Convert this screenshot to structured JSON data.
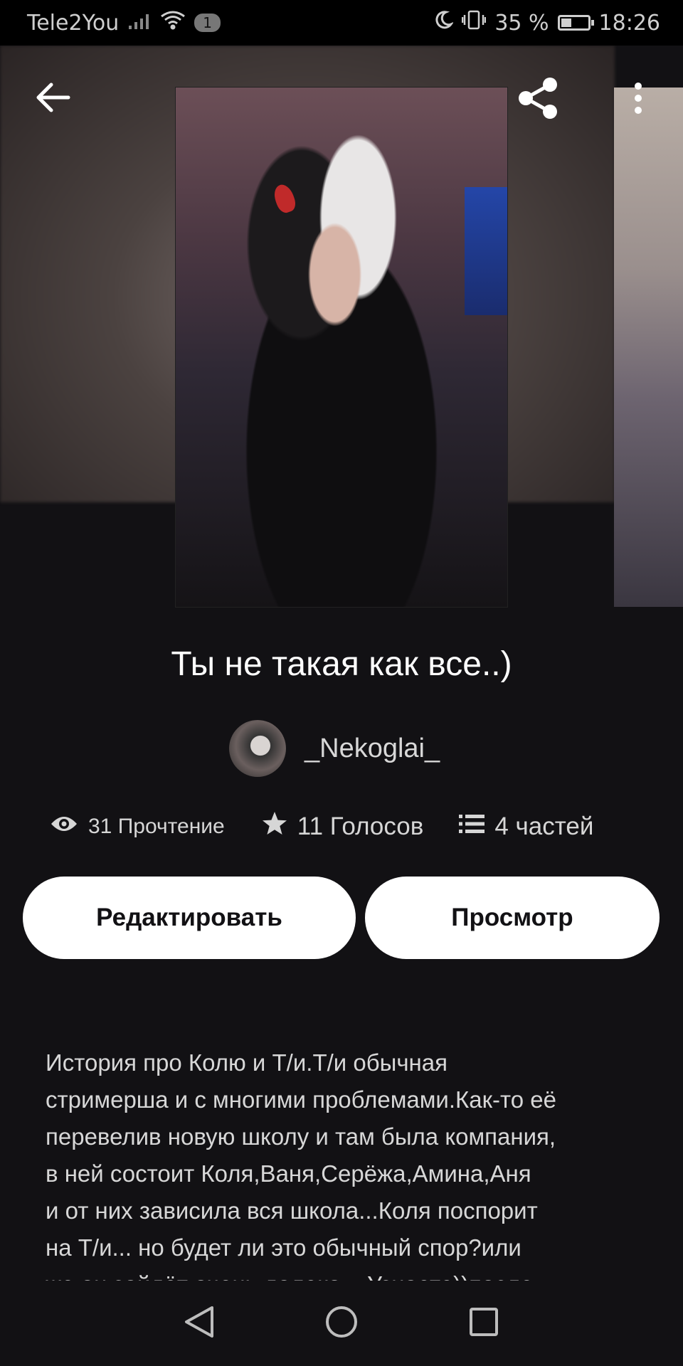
{
  "status_bar": {
    "carrier": "Tele2You",
    "notification_count": "1",
    "battery_text": "35 %",
    "time": "18:26",
    "battery_level": 0.35
  },
  "book": {
    "title": "Ты не такая как все..)",
    "author": "_Nekoglai_"
  },
  "stats": {
    "reads": "31 Прочтение",
    "votes": "11 Голосов",
    "parts": "4 частей"
  },
  "buttons": {
    "edit": "Редактировать",
    "view": "Просмотр"
  },
  "description": [
    "История про Колю и Т/и.Т/и обычная",
    "стримерша и с многими проблемами.Как-то её",
    "перевелив новую школу и там была компания,",
    "в ней состоит Коля,Ваня,Серёжа,Амина,Аня",
    "и от них зависила вся школа...Коля поспорит",
    "на Т/и... но будет ли это обычный спор?или",
    "же он зайдёт очень далеко... Узнаете))после"
  ],
  "icons": {
    "back": "arrow-left-icon",
    "share": "share-icon",
    "more": "more-vertical-icon",
    "reads": "eye-icon",
    "votes": "star-icon",
    "parts": "list-icon"
  }
}
